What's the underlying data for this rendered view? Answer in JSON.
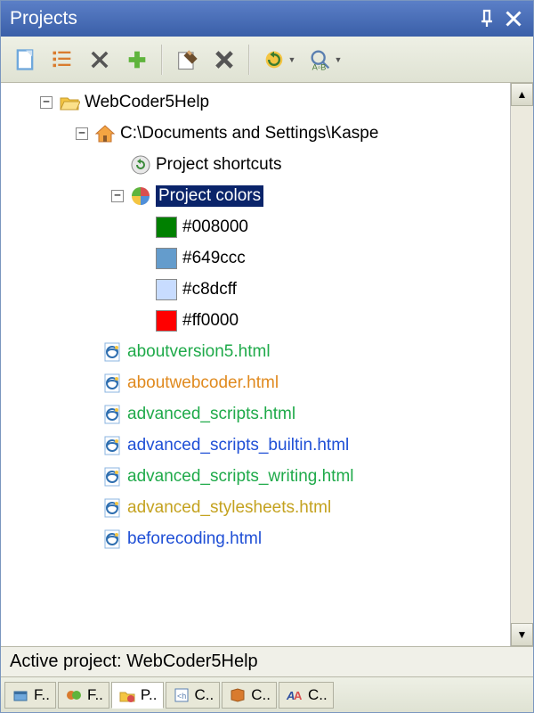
{
  "title": "Projects",
  "toolbar": {
    "new": "New",
    "list": "List",
    "remove": "Remove",
    "add": "Add",
    "edit": "Edit",
    "delete": "Delete",
    "refresh": "Refresh",
    "find": "Find"
  },
  "tree": {
    "root": {
      "label": "WebCoder5Help"
    },
    "path": {
      "label": "C:\\Documents and Settings\\Kaspe"
    },
    "shortcuts": {
      "label": "Project shortcuts"
    },
    "colors": {
      "label": "Project colors",
      "items": [
        {
          "hex": "#008000",
          "name": "color-008000"
        },
        {
          "hex": "#649ccc",
          "name": "color-649ccc"
        },
        {
          "hex": "#c8dcff",
          "name": "color-c8dcff"
        },
        {
          "hex": "#ff0000",
          "name": "color-ff0000"
        }
      ]
    },
    "files": [
      {
        "name": "aboutversion5.html",
        "color": "#1faa4a"
      },
      {
        "name": "aboutwebcoder.html",
        "color": "#e08a1f"
      },
      {
        "name": "advanced_scripts.html",
        "color": "#1faa4a"
      },
      {
        "name": "advanced_scripts_builtin.html",
        "color": "#1f4fd6"
      },
      {
        "name": "advanced_scripts_writing.html",
        "color": "#1faa4a"
      },
      {
        "name": "advanced_stylesheets.html",
        "color": "#c4a21f"
      },
      {
        "name": "beforecoding.html",
        "color": "#1f4fd6"
      }
    ]
  },
  "status": {
    "text": "Active project: WebCoder5Help"
  },
  "tabs": [
    {
      "label": "F..",
      "active": false
    },
    {
      "label": "F..",
      "active": false
    },
    {
      "label": "P..",
      "active": true
    },
    {
      "label": "C..",
      "active": false
    },
    {
      "label": "C..",
      "active": false
    },
    {
      "label": "C..",
      "active": false
    }
  ]
}
